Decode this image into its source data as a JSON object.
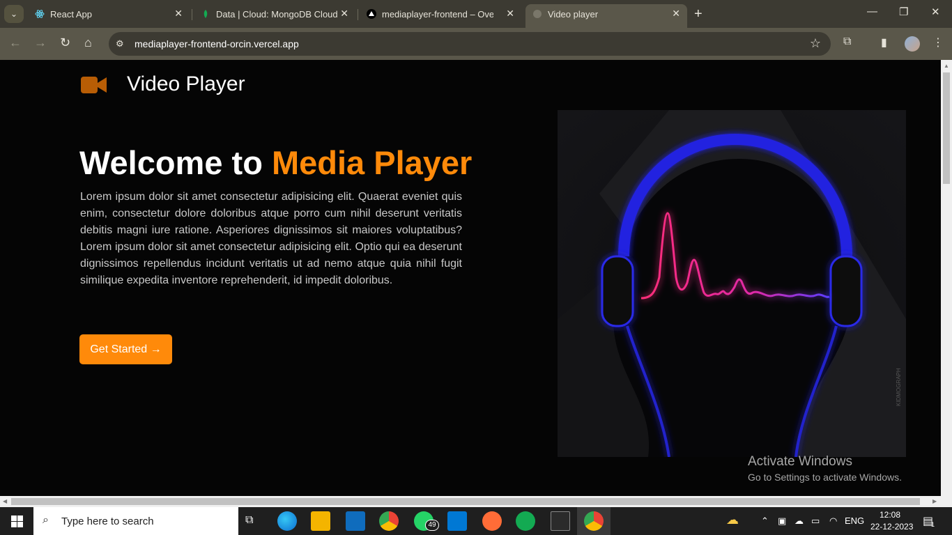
{
  "browser": {
    "tabs": [
      {
        "title": "React App",
        "icon": "react-icon"
      },
      {
        "title": "Data | Cloud: MongoDB Cloud",
        "icon": "mongodb-icon"
      },
      {
        "title": "mediaplayer-frontend – Overvie",
        "icon": "vercel-icon"
      },
      {
        "title": "Video player",
        "icon": "globe-icon",
        "active": true
      }
    ],
    "url": "mediaplayer-frontend-orcin.vercel.app"
  },
  "page": {
    "brand": "Video Player",
    "hero_title_plain": "Welcome to ",
    "hero_title_accent": "Media Player",
    "hero_text": "Lorem ipsum dolor sit amet consectetur adipisicing elit. Quaerat eveniet quis enim, consectetur dolore doloribus atque porro cum nihil deserunt veritatis debitis magni iure ratione. Asperiores dignissimos sit maiores voluptatibus? Lorem ipsum dolor sit amet consectetur adipisicing elit. Optio qui ea deserunt dignissimos repellendus incidunt veritatis ut ad nemo atque quia nihil fugit similique expedita inventore reprehenderit, id impedit doloribus.",
    "cta": "Get Started →",
    "art_credit": "KIDMOGRAPH",
    "accent_color": "#ff8a0a"
  },
  "watermark": {
    "line1": "Activate Windows",
    "line2": "Go to Settings to activate Windows."
  },
  "taskbar": {
    "search_placeholder": "Type here to search",
    "whatsapp_badge": "49",
    "language": "ENG",
    "time": "12:08",
    "date": "22-12-2023",
    "notification_count": "1"
  }
}
